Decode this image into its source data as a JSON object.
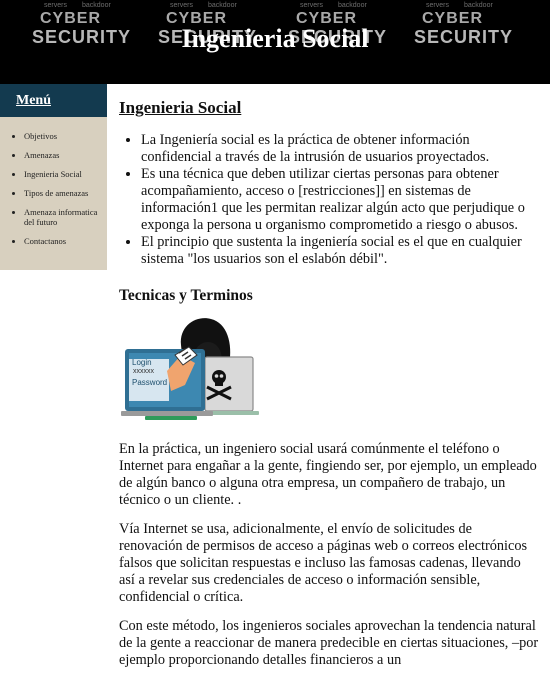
{
  "banner": {
    "title": "Ingenieria Social",
    "tile_word1": "CYBER",
    "tile_word2": "SECURITY",
    "tile_small": [
      "servers",
      "backdoor",
      "access",
      "hacker"
    ]
  },
  "sidebar": {
    "heading": "Menú",
    "items": [
      {
        "label": "Objetivos"
      },
      {
        "label": "Amenazas"
      },
      {
        "label": "Ingenieria Social"
      },
      {
        "label": "Tipos de amenazas"
      },
      {
        "label": "Amenaza informatica del futuro"
      },
      {
        "label": "Contactanos"
      }
    ]
  },
  "main": {
    "title": "Ingenieria Social",
    "bullets": [
      "La Ingeniería social es la práctica de obtener información confidencial a través de la intrusión de usuarios proyectados.",
      "Es una técnica que deben utilizar ciertas personas para obtener acompañamiento, acceso o [restricciones]] en sistemas de información1 que les permitan realizar algún acto que perjudique o exponga la persona u organismo comprometido a riesgo o abusos.",
      "El principio que sustenta la ingeniería social es el que en cualquier sistema \"los usuarios son el eslabón débil\"."
    ],
    "subtitle": "Tecnicas y Terminos",
    "illustration": {
      "login_label": "Login",
      "password_label": "Password",
      "login_mask": "xxxxxx"
    },
    "paragraphs": [
      "En la práctica, un ingeniero social usará comúnmente el teléfono o Internet para engañar a la gente, fingiendo ser, por ejemplo, un empleado de algún banco o alguna otra empresa, un compañero de trabajo, un técnico o un cliente. .",
      "Vía Internet se usa, adicionalmente, el envío de solicitudes de renovación de permisos de acceso a páginas web o correos electrónicos falsos que solicitan respuestas e incluso las famosas cadenas, llevando así a revelar sus credenciales de acceso o información sensible, confidencial o crítica.",
      "Con este método, los ingenieros sociales aprovechan la tendencia natural de la gente a reaccionar de manera predecible en ciertas situaciones, –por ejemplo proporcionando detalles financieros a un"
    ]
  }
}
